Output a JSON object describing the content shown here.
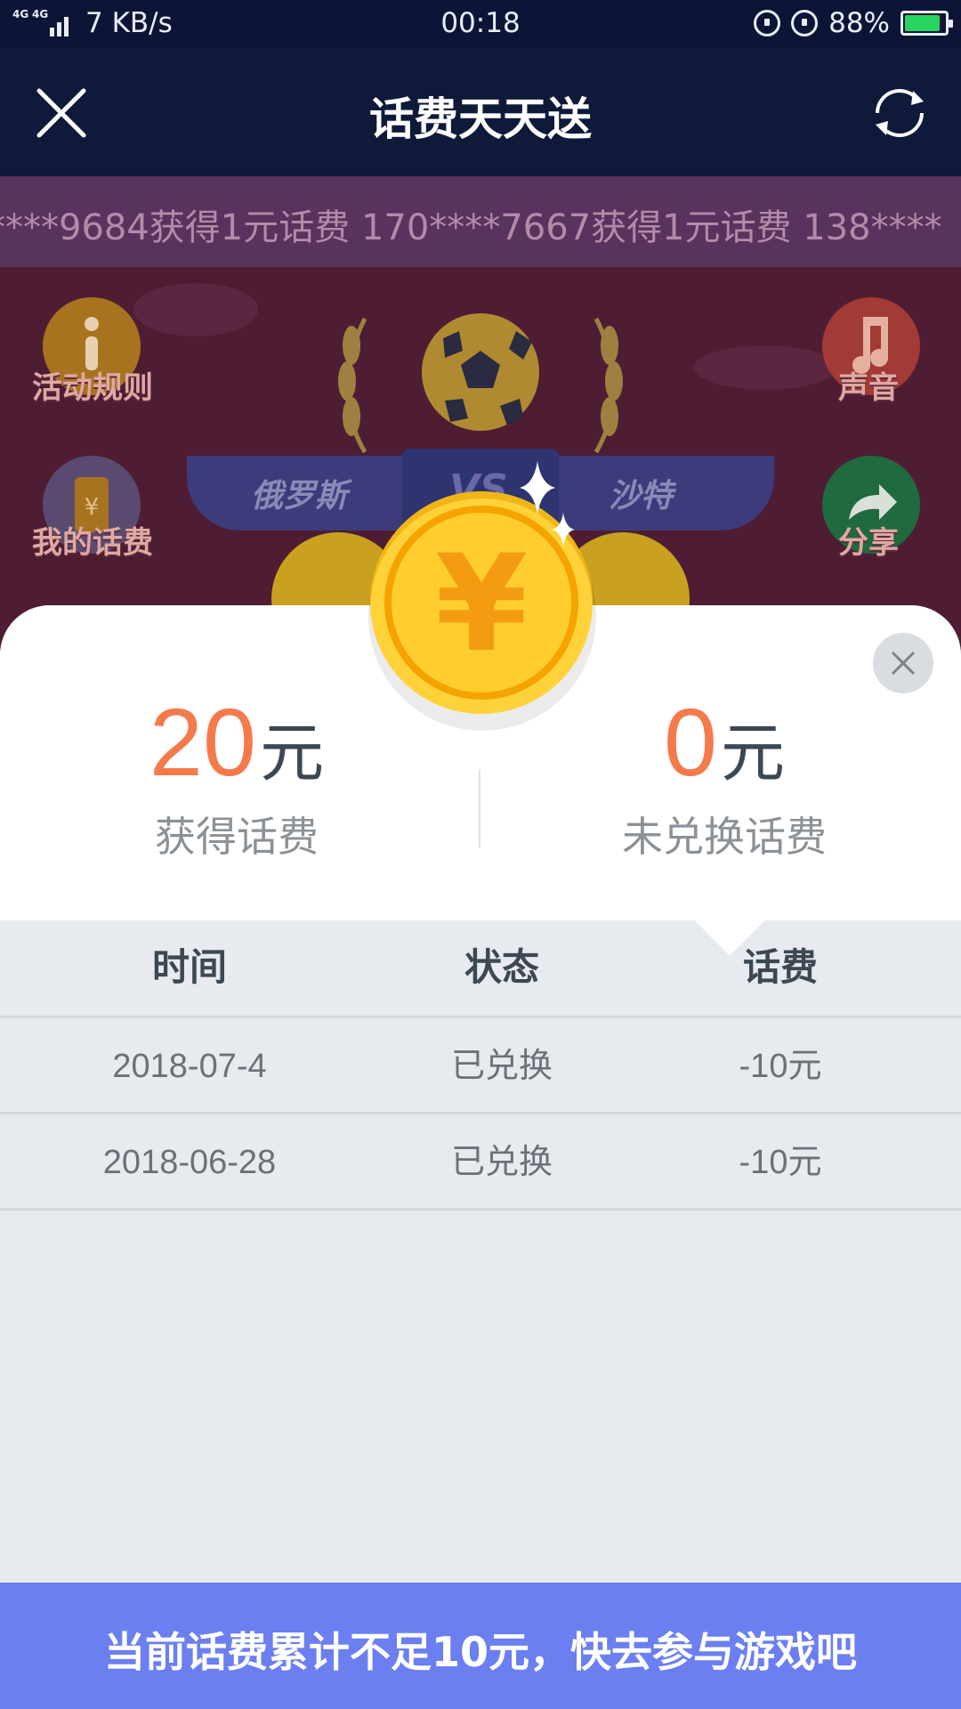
{
  "status_bar": {
    "network_type": "4G",
    "network_type_2": "4G",
    "speed": "7 KB/s",
    "time": "00:18",
    "battery": "88%"
  },
  "title_bar": {
    "title": "话费天天送"
  },
  "scene": {
    "marquee": "****9684获得1元话费   170****7667获得1元话费   138****",
    "rules_label": "活动规则",
    "my_fee_label": "我的话费",
    "sound_label": "声音",
    "share_label": "分享",
    "team_left": "俄罗斯",
    "vs": "VS",
    "team_right": "沙特"
  },
  "popup": {
    "earned_amount": "20",
    "earned_unit": "元",
    "earned_label": "获得话费",
    "unredeemed_amount": "0",
    "unredeemed_unit": "元",
    "unredeemed_label": "未兑换话费",
    "table": {
      "headers": [
        "时间",
        "状态",
        "话费"
      ],
      "rows": [
        [
          "2018-07-4",
          "已兑换",
          "-10元"
        ],
        [
          "2018-06-28",
          "已兑换",
          "-10元"
        ]
      ]
    }
  },
  "bottom_banner": {
    "text": "当前话费累计不足10元，快去参与游戏吧"
  },
  "colors": {
    "accent_orange": "#f47a4c",
    "banner_blue": "#6b7ff0",
    "coin_gold": "#ffd23a"
  },
  "icons": [
    "close-icon",
    "refresh-icon",
    "info-icon",
    "phone-yen-icon",
    "music-icon",
    "share-arrow-icon",
    "coin-yen-icon",
    "close-circle-icon"
  ]
}
